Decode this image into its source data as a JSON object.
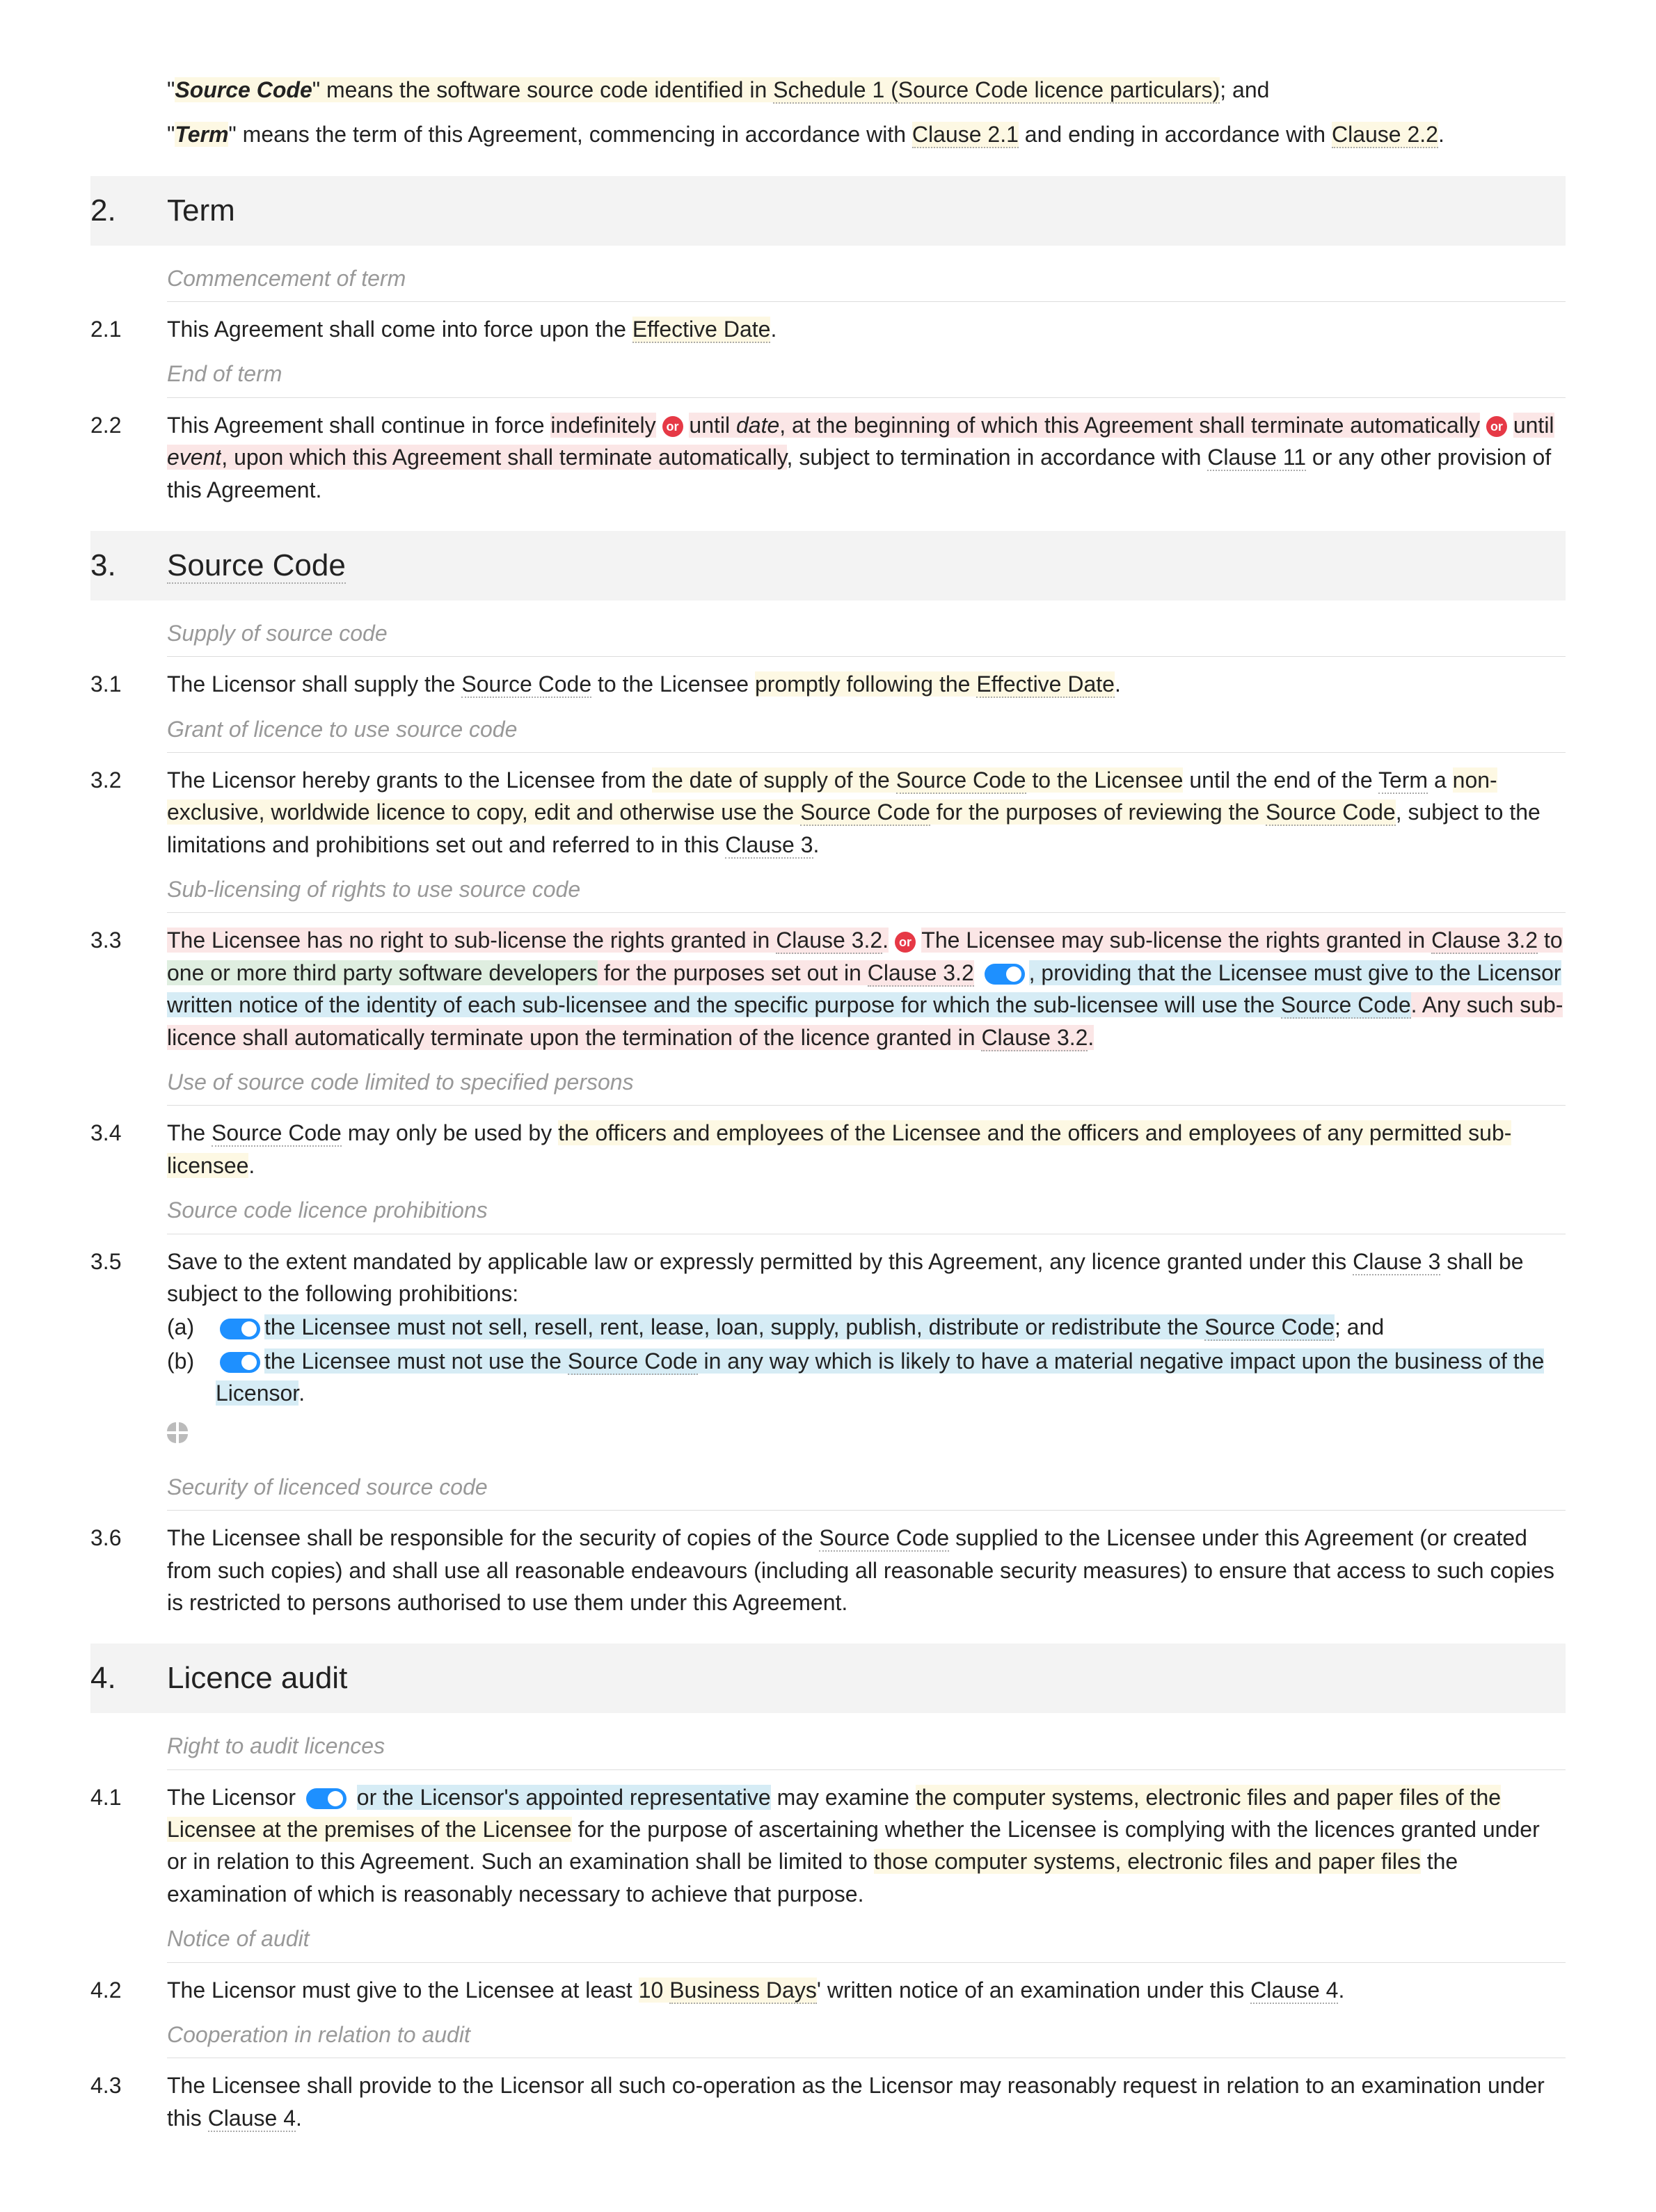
{
  "def_source_code": {
    "term": "Source Code",
    "text1": "\" means the software source code identified in ",
    "ref": "Schedule 1 (Source Code licence particulars)",
    "text2": "; and"
  },
  "def_term": {
    "term": "Term",
    "text1": "\" means the term of this Agreement, commencing in accordance with ",
    "ref1": "Clause 2.1",
    "text2": " and ending in accordance with ",
    "ref2": "Clause 2.2",
    "text3": "."
  },
  "s2": {
    "num": "2.",
    "title": "Term",
    "sub1": "Commencement of term",
    "c21_num": "2.1",
    "c21_a": "This Agreement shall come into force upon the ",
    "c21_eff": "Effective Date",
    "c21_b": ".",
    "sub2": "End of term",
    "c22_num": "2.2",
    "c22_a": "This Agreement shall continue in force ",
    "c22_indef": "indefinitely",
    "c22_or": "or",
    "c22_until1": " until ",
    "c22_date": "date",
    "c22_b": ", at the beginning of which this Agreement shall terminate automatically",
    "c22_until2": " until ",
    "c22_event": "event",
    "c22_c": ", upon which this Agreement shall terminate automatically",
    "c22_d": ", subject to termination in accordance with ",
    "c22_cl11": "Clause 11",
    "c22_e": " or any other provision of this Agreement."
  },
  "s3": {
    "num": "3.",
    "title": "Source Code",
    "sub1": "Supply of source code",
    "c31_num": "3.1",
    "c31_a": "The Licensor shall supply the ",
    "c31_sc": "Source Code",
    "c31_b": " to the Licensee ",
    "c31_prompt": "promptly following the ",
    "c31_eff": "Effective Date",
    "c31_c": ".",
    "sub2": "Grant of licence to use source code",
    "c32_num": "3.2",
    "c32_a": "The Licensor hereby grants to the Licensee from ",
    "c32_date": "the date of supply of the ",
    "c32_sc1": "Source Code",
    "c32_date2": " to the Licensee",
    "c32_b": " until the end of the ",
    "c32_term": "Term",
    "c32_c": " a ",
    "c32_lic": "non-exclusive, worldwide licence to copy, edit and otherwise use the ",
    "c32_sc2": "Source Code",
    "c32_purp": " for the purposes of reviewing the ",
    "c32_sc3": "Source Code",
    "c32_d": ", subject to the limitations and prohibitions set out and referred to in this ",
    "c32_cl3": "Clause 3",
    "c32_e": ".",
    "sub3": "Sub-licensing of rights to use source code",
    "c33_num": "3.3",
    "c33_opt1a": "The Licensee has no right to sub-license the rights granted in ",
    "c33_cl32a": "Clause 3.2",
    "c33_opt1b": ".",
    "c33_or": "or",
    "c33_opt2a": "The Licensee may sub-license the rights granted in ",
    "c33_cl32b": "Clause 3.2",
    "c33_opt2b": " to ",
    "c33_who": "one or more third party software developers",
    "c33_opt2c": " for the purposes set out in ",
    "c33_cl32c": "Clause 3.2",
    "c33_tog": ", providing that the Licensee must give to the Licensor written notice of the identity of each sub-licensee and the specific purpose for which the sub-licensee will use the ",
    "c33_sc": "Source Code",
    "c33_opt2d": ". Any such sub-licence shall automatically terminate upon the termination of the licence granted in ",
    "c33_cl32d": "Clause 3.2",
    "c33_opt2e": ".",
    "sub4": "Use of source code limited to specified persons",
    "c34_num": "3.4",
    "c34_a": "The ",
    "c34_sc": "Source Code",
    "c34_b": " may only be used by ",
    "c34_who": "the officers and employees of the Licensee and the officers and employees of any permitted sub-licensee",
    "c34_c": ".",
    "sub5": "Source code licence prohibitions",
    "c35_num": "3.5",
    "c35_a": "Save to the extent mandated by applicable law or expressly permitted by this Agreement, any licence granted under this ",
    "c35_cl3": "Clause 3",
    "c35_b": " shall be subject to the following prohibitions:",
    "c35_la": "(a)",
    "c35_a1": "the Licensee must not sell, resell, rent, lease, loan, supply, publish, distribute or redistribute the ",
    "c35_sc1": "Source Code",
    "c35_a2": "; and",
    "c35_lb": "(b)",
    "c35_b1": "the Licensee must not use the ",
    "c35_sc2": "Source Code",
    "c35_b2": " in any way which is likely to have a material negative impact upon the business of the Licensor",
    "c35_b3": ".",
    "sub6": "Security of licenced source code",
    "c36_num": "3.6",
    "c36_a": "The Licensee shall be responsible for the security of copies of the ",
    "c36_sc": "Source Code",
    "c36_b": " supplied to the Licensee under this Agreement (or created from such copies) and shall use all reasonable endeavours (including all reasonable security measures) to ensure that access to such copies is restricted to persons authorised to use them under this Agreement."
  },
  "s4": {
    "num": "4.",
    "title": "Licence audit",
    "sub1": "Right to audit licences",
    "c41_num": "4.1",
    "c41_a": "The Licensor ",
    "c41_rep": "or the Licensor's appointed representative",
    "c41_b": " may examine ",
    "c41_what1": "the computer systems, electronic files and paper files of the Licensee at the premises of the Licensee",
    "c41_c": " for the purpose of ascertaining whether the Licensee is complying with the licences granted under or in relation to this Agreement. Such an examination shall be limited to ",
    "c41_what2": "those computer systems, electronic files and paper files",
    "c41_d": " the examination of which is reasonably necessary to achieve that purpose.",
    "sub2": "Notice of audit",
    "c42_num": "4.2",
    "c42_a": "The Licensor must give to the Licensee at least ",
    "c42_days": "10 ",
    "c42_bd": "Business Days",
    "c42_b": "' written notice of an examination under this ",
    "c42_cl4": "Clause 4",
    "c42_c": ".",
    "sub3": "Cooperation in relation to audit",
    "c43_num": "4.3",
    "c43_a": "The Licensee shall provide to the Licensor all such co-operation as the Licensor may reasonably request in relation to an examination under this ",
    "c43_cl4": "Clause 4",
    "c43_b": "."
  }
}
